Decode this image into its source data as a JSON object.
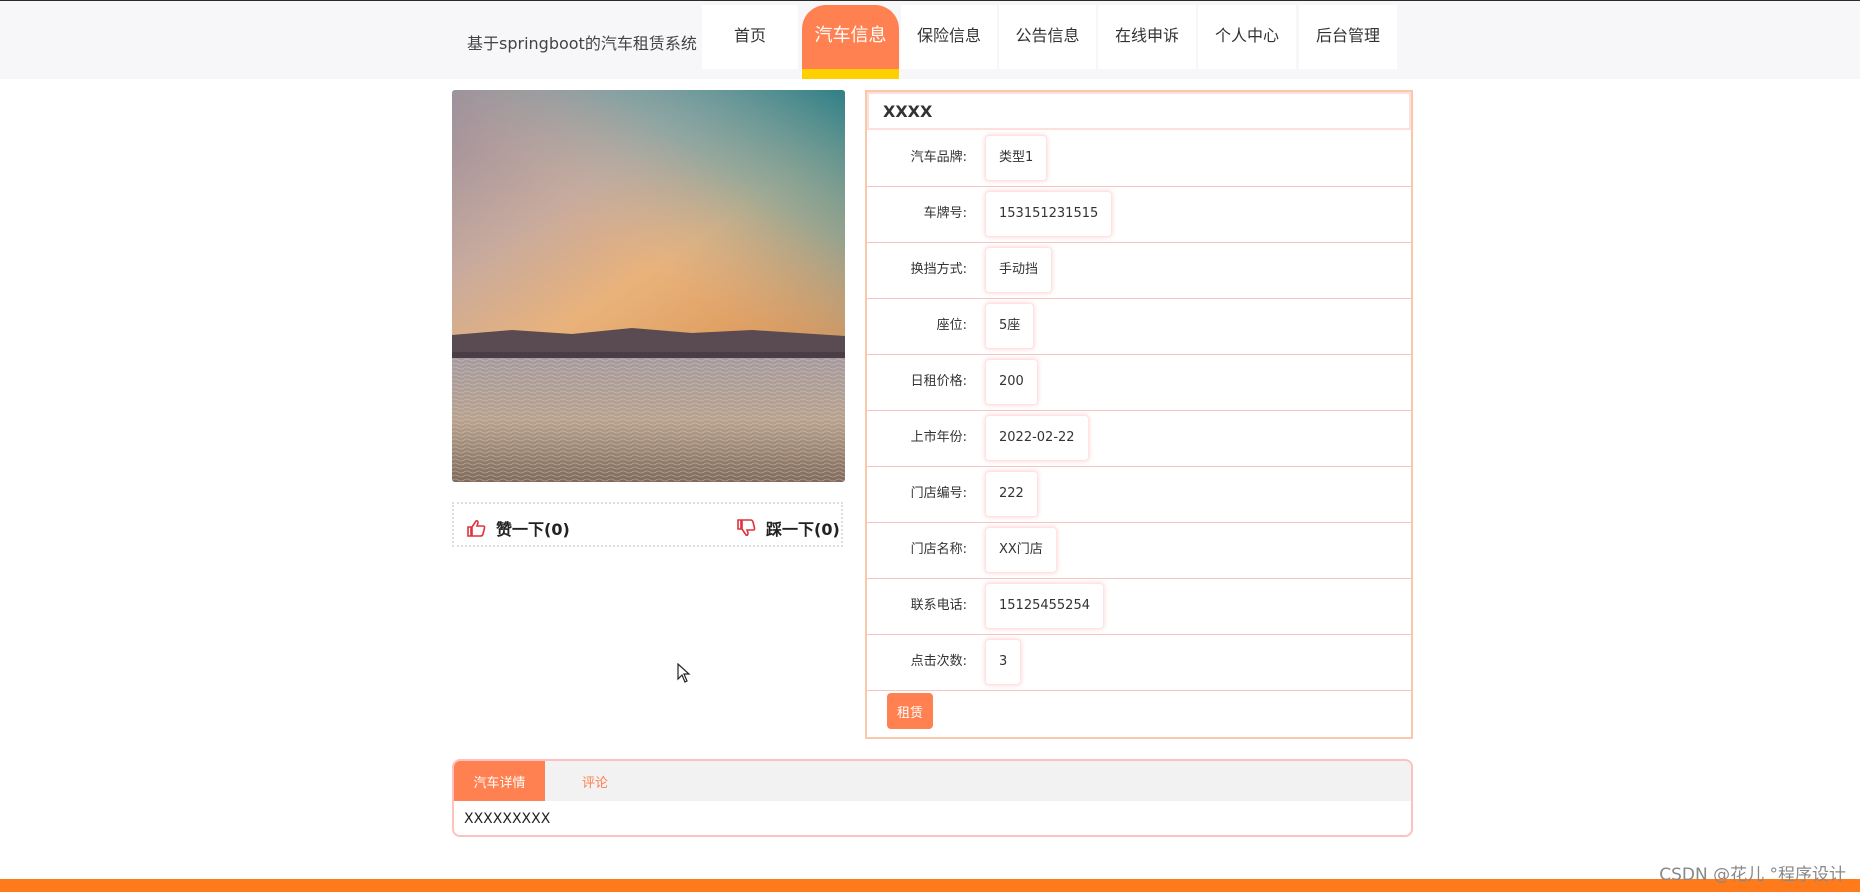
{
  "header": {
    "brand": "基于springboot的汽车租赁系统",
    "nav": [
      {
        "label": "首页"
      },
      {
        "label": "汽车信息",
        "active": true
      },
      {
        "label": "保险信息"
      },
      {
        "label": "公告信息"
      },
      {
        "label": "在线申诉"
      },
      {
        "label": "个人中心"
      },
      {
        "label": "后台管理"
      }
    ]
  },
  "gallery": {
    "image": "sunset-lake-photo"
  },
  "votes": {
    "like": "赞一下(0)",
    "dislike": "踩一下(0)"
  },
  "detail": {
    "title": "XXXX",
    "fields": [
      {
        "label": "汽车品牌:",
        "value": "类型1"
      },
      {
        "label": "车牌号:",
        "value": "153151231515"
      },
      {
        "label": "换挡方式:",
        "value": "手动挡"
      },
      {
        "label": "座位:",
        "value": "5座"
      },
      {
        "label": "日租价格:",
        "value": "200"
      },
      {
        "label": "上市年份:",
        "value": "2022-02-22"
      },
      {
        "label": "门店编号:",
        "value": "222"
      },
      {
        "label": "门店名称:",
        "value": "XX门店"
      },
      {
        "label": "联系电话:",
        "value": "15125455254"
      },
      {
        "label": "点击次数:",
        "value": "3"
      }
    ],
    "rent_button": "租赁"
  },
  "tabs": {
    "items": [
      {
        "label": "汽车详情",
        "active": true
      },
      {
        "label": "评论"
      }
    ],
    "content": "XXXXXXXXX"
  },
  "watermark": "CSDN @花儿 °程序设计",
  "colors": {
    "accent": "#ff8050",
    "nav_underline": "#ffd000",
    "footer": "#ff7a1a",
    "border_pink": "#f7c3c3"
  }
}
